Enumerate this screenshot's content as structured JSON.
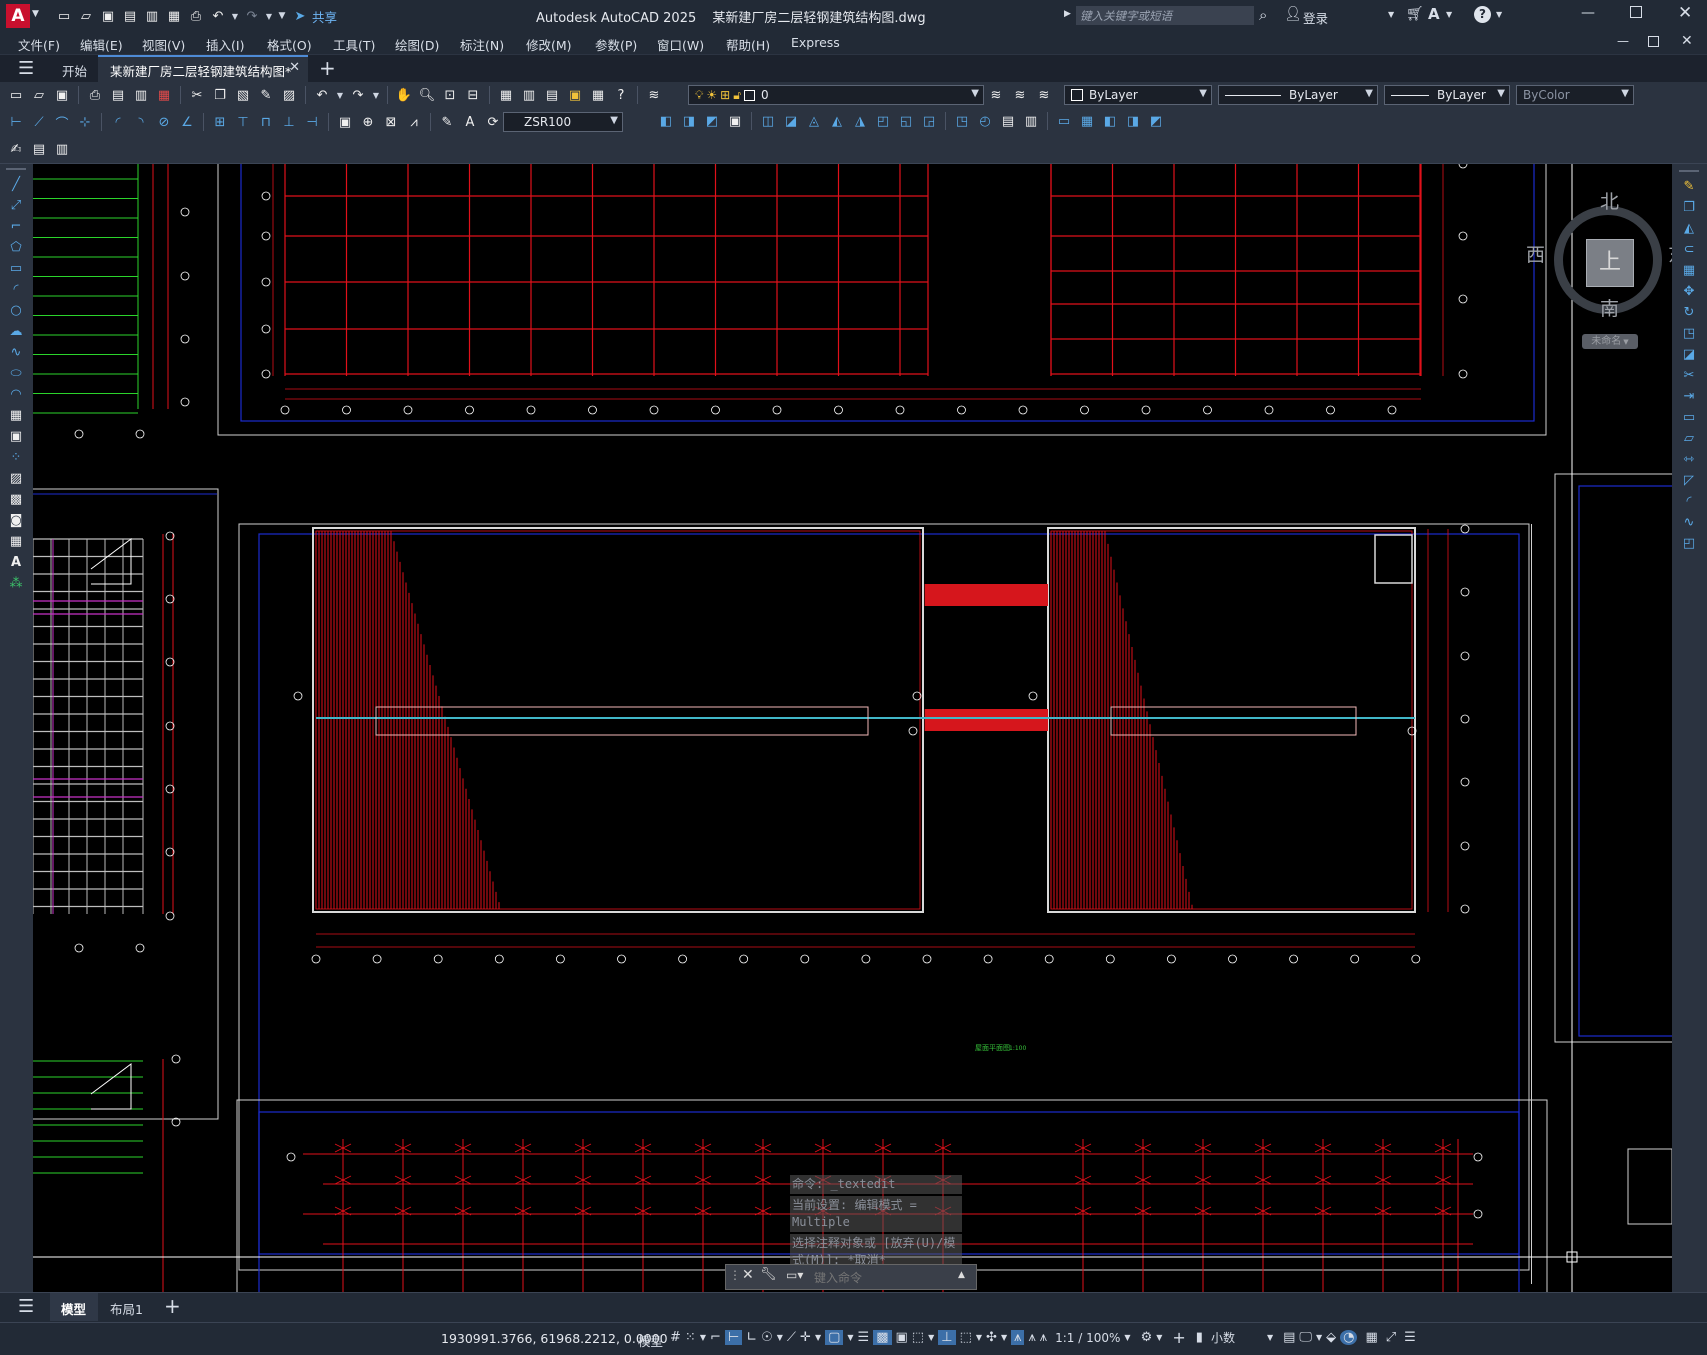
{
  "app": {
    "logo": "A",
    "title": "Autodesk AutoCAD 2025",
    "filename": "某新建厂房二层轻钢建筑结构图.dwg",
    "share": "共享",
    "search_placeholder": "键入关键字或短语",
    "login": "登录",
    "accent": "#c8102e"
  },
  "menu": [
    "文件(F)",
    "编辑(E)",
    "视图(V)",
    "插入(I)",
    "格式(O)",
    "工具(T)",
    "绘图(D)",
    "标注(N)",
    "修改(M)",
    "参数(P)",
    "窗口(W)",
    "帮助(H)",
    "Express"
  ],
  "tabs": {
    "start": "开始",
    "active": "某新建厂房二层轻钢建筑结构图*"
  },
  "toolbar": {
    "layer_value": "0",
    "color": "ByLayer",
    "linetype": "ByLayer",
    "lineweight": "ByLayer",
    "plotstyle": "ByColor",
    "dimstyle": "ZSR100"
  },
  "viewcube": {
    "north": "北",
    "south": "南",
    "east": "东",
    "west": "西",
    "top": "上",
    "wcs": "未命名"
  },
  "command": {
    "history": [
      "命令: _textedit",
      "当前设置: 编辑模式 = Multiple",
      "选择注释对象或 [放弃(U)/模式(M)]: *取消*"
    ],
    "placeholder": "键入命令"
  },
  "layout_tabs": [
    "模型",
    "布局1"
  ],
  "status": {
    "coords": "1930991.3766, 61968.2212, 0.0000",
    "model": "模型",
    "scale": "1:1 / 100%",
    "units": "小数"
  },
  "drawing": {
    "plan_title": "屋面平面图",
    "scale_note": "1:100"
  }
}
